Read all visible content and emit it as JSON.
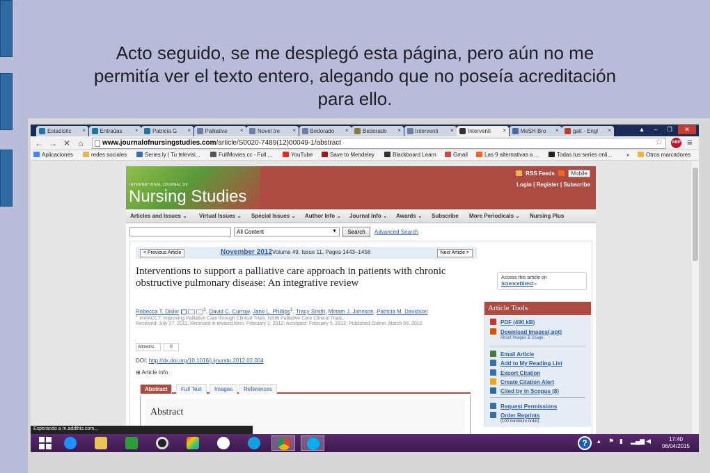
{
  "slide": {
    "text_lines": [
      "Acto seguido, se me desplegó esta página, pero aún no me",
      "permitía ver el texto entero, alegando que no poseía acreditación",
      "para ello."
    ]
  },
  "browser": {
    "tabs": [
      {
        "label": "Estadístic",
        "icon_color": "#21759b"
      },
      {
        "label": "Entradas",
        "icon_color": "#21759b"
      },
      {
        "label": "Patricia G",
        "icon_color": "#21759b"
      },
      {
        "label": "Palliative",
        "icon_color": "#6b7fa3"
      },
      {
        "label": "Novel tre",
        "icon_color": "#6b7fa3"
      },
      {
        "label": "Bedorado",
        "icon_color": "#6b7fa3"
      },
      {
        "label": "Bedorado",
        "icon_color": "#8a7a3a"
      },
      {
        "label": "Interventi",
        "icon_color": "#6b7fa3"
      },
      {
        "label": "Interventi",
        "icon_color": "#333333"
      },
      {
        "label": "MeSH Bro",
        "icon_color": "#4a6aa0"
      },
      {
        "label": "gait - Engl",
        "icon_color": "#c0392b"
      }
    ],
    "url_domain": "www.journalofnursingstudies.com",
    "url_path": "/article/S0020-7489(12)00049-1/abstract",
    "bookmarks": [
      "Aplicaciones",
      "redes sociales",
      "Series.ly | Tu televisi...",
      "FullMovies.cc - Full ...",
      "YouTube",
      "Save to Mendeley",
      "Blackboard Learn",
      "Gmail",
      "Las 9 alternativas a ...",
      "Todas tus series onli...",
      "»",
      "Otros marcadores"
    ],
    "status": "Esperando a m.addthis.com..."
  },
  "page": {
    "logo_small": "INTERNATIONAL JOURNAL OF",
    "logo_big": "Nursing Studies",
    "rss": "RSS Feeds",
    "mobile": "Mobile",
    "login": "Login",
    "register": "Register",
    "subscribe": "Subscribe",
    "nav": [
      "Articles and Issues ⌄",
      "Virtual Issues ⌄",
      "Special Issues ⌄",
      "Author Info ⌄",
      "Journal Info ⌄",
      "Awards ⌄",
      "Subscribe",
      "More Periodicals ⌄",
      "Nursing Plus"
    ],
    "search_scope": "All Content",
    "search_button": "Search",
    "advanced_search": "Advanced Search",
    "prev_article": "< Previous Article",
    "next_article": "Next Article >",
    "issue_date": "November 2012",
    "issue_info": "Volume 49, Issue 11, Pages 1443–1458",
    "title": "Interventions to support a palliative care approach in patients with chronic obstructive pulmonary disease: An integrative review",
    "authors": [
      "Rebecca T. Disler",
      "David C. Currow",
      "Jane L. Phillips",
      "Tracy Smith",
      "Miriam J. Johnson",
      "Patricia M. Davidson"
    ],
    "affiliation": "ImPACCT: Improving Palliative Care through Clinical Trials. NSW Palliative Care Clinical Trials.",
    "dates": "Received: July 27, 2011; Received in revised form: February 2, 2012; Accepted: February 5, 2012; Published Online: March 09, 2012",
    "altmetric_label": "Altmetric",
    "altmetric_count": "0",
    "doi_label": "DOI:",
    "doi_link": "http://dx.doi.org/10.1016/j.ijnurstu.2012.02.004",
    "article_info": "Article Info",
    "tabs": [
      "Abstract",
      "Full Text",
      "Images",
      "References"
    ],
    "abstract_heading": "Abstract",
    "access_line": "Access this article on",
    "access_link": "ScienceDirect",
    "tools_heading": "Article Tools",
    "tools": [
      {
        "label": "PDF (490 kB)",
        "color": "#c0392b"
      },
      {
        "label": "Download Images(.ppt)",
        "sub": "About Images & Usage",
        "color": "#d35400"
      },
      {
        "label": "Email Article",
        "color": "#4a7a3a"
      },
      {
        "label": "Add to My Reading List",
        "color": "#3a6ea5"
      },
      {
        "label": "Export Citation",
        "color": "#3a6ea5"
      },
      {
        "label": "Create Citation Alert",
        "color": "#e6a817"
      },
      {
        "label": "Cited by in Scopus (8)",
        "color": "#2a6aa0"
      },
      {
        "label": "Request Permissions",
        "color": "#3a6ea5"
      },
      {
        "label": "Order Reprints",
        "sub": "(100 minimum order)",
        "color": "#3a6ea5"
      }
    ]
  },
  "taskbar": {
    "time": "17:40",
    "date": "06/04/2015"
  }
}
